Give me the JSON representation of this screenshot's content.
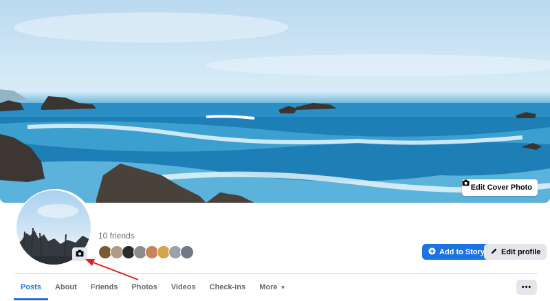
{
  "cover": {
    "edit_label": "Edit Cover Photo",
    "camera_icon": "camera-icon"
  },
  "profile": {
    "friends_count": "10 friends",
    "avatar_camera_icon": "camera-icon",
    "friend_avatar_colors": [
      "#7a5a2e",
      "#b09b86",
      "#2b2b2b",
      "#8d8d8d",
      "#c7835a",
      "#d8a34a",
      "#9aa3ad",
      "#6f7a85"
    ]
  },
  "actions": {
    "add_story": "Add to Story",
    "edit_profile": "Edit profile",
    "plus_icon": "plus-circle-icon",
    "pencil_icon": "pencil-icon"
  },
  "tabs": [
    {
      "label": "Posts",
      "active": true
    },
    {
      "label": "About"
    },
    {
      "label": "Friends"
    },
    {
      "label": "Photos"
    },
    {
      "label": "Videos"
    },
    {
      "label": "Check-ins"
    },
    {
      "label": "More"
    }
  ],
  "options_label": "•••",
  "colors": {
    "accent": "#1b74e4",
    "annotation": "#e02020"
  }
}
